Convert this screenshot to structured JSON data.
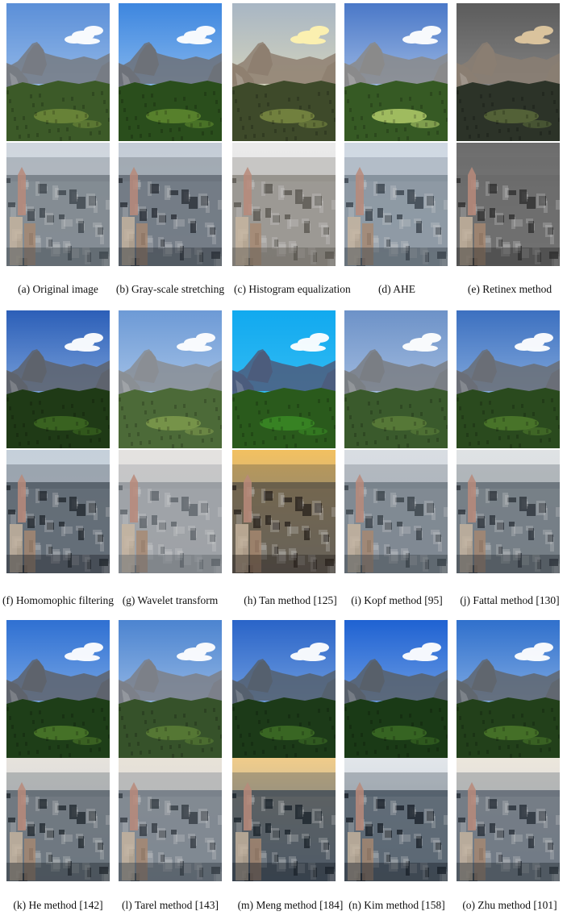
{
  "groups": [
    {
      "captions": [
        "(a) Original image",
        "(b) Gray-scale stretching",
        "(c) Histogram equalization",
        "(d) AHE",
        "(e) Retinex method"
      ],
      "panels": [
        {
          "mountain": {
            "sky_top": "#5b8fd8",
            "sky_bottom": "#b7d3f2",
            "cliff": "#777b83",
            "forest": "#3c5a28",
            "meadow": "#6f8a3a",
            "cloud": "#ffffff"
          },
          "city": {
            "sky": "#cfd6de",
            "haze": "#d9dee4",
            "buildings": "#6f7880",
            "shade": "#3f464d"
          }
        },
        {
          "mountain": {
            "sky_top": "#3d86df",
            "sky_bottom": "#b5d7f7",
            "cliff": "#6d7178",
            "forest": "#2a4e1c",
            "meadow": "#5f8a2f",
            "cloud": "#ffffff"
          },
          "city": {
            "sky": "#c4ccd6",
            "haze": "#d2dae2",
            "buildings": "#5e6770",
            "shade": "#2a3037"
          }
        },
        {
          "mountain": {
            "sky_top": "#a8b6c4",
            "sky_bottom": "#f0e6b8",
            "cliff": "#8e7f70",
            "forest": "#3e4a2a",
            "meadow": "#7a8a42",
            "cloud": "#fff3b0"
          },
          "city": {
            "sky": "#eaeaea",
            "haze": "#e2e2e2",
            "buildings": "#8a8680",
            "shade": "#5a5650"
          }
        },
        {
          "mountain": {
            "sky_top": "#4a78c8",
            "sky_bottom": "#d2e2f5",
            "cliff": "#8a8a8a",
            "forest": "#365a24",
            "meadow": "#b2cc6a",
            "cloud": "#ffffff"
          },
          "city": {
            "sky": "#cfd8e2",
            "haze": "#dde4ec",
            "buildings": "#7c8894",
            "shade": "#3a424c"
          }
        },
        {
          "mountain": {
            "sky_top": "#5c5c5c",
            "sky_bottom": "#9c9c9c",
            "cliff": "#8a7e72",
            "forest": "#2c3328",
            "meadow": "#5a6a3a",
            "cloud": "#e0c8a0"
          },
          "city": {
            "sky": "#6c6c6c",
            "haze": "#8a8a8a",
            "buildings": "#6a6a6a",
            "shade": "#2e2e2e"
          }
        }
      ]
    },
    {
      "captions": [
        "(f) Homomophic filtering",
        "(g) Wavelet transform",
        "(h) Tan method [125]",
        "(i) Kopf method [95]",
        "(j) Fattal method [130]"
      ],
      "panels": [
        {
          "mountain": {
            "sky_top": "#2c5fb8",
            "sky_bottom": "#a9c9ee",
            "cliff": "#5e636c",
            "forest": "#1f3a16",
            "meadow": "#3e6a22",
            "cloud": "#ffffff"
          },
          "city": {
            "sky": "#c5d0da",
            "haze": "#d0d8e0",
            "buildings": "#4a545e",
            "shade": "#23292f"
          }
        },
        {
          "mountain": {
            "sky_top": "#6d9ad6",
            "sky_bottom": "#c8dcf1",
            "cliff": "#8a8e94",
            "forest": "#4c6a38",
            "meadow": "#7e9a4c",
            "cloud": "#ffffff"
          },
          "city": {
            "sky": "#e4e2e0",
            "haze": "#dcdcdc",
            "buildings": "#8e949a",
            "shade": "#5e646a"
          }
        },
        {
          "mountain": {
            "sky_top": "#11a9ef",
            "sky_bottom": "#48c8f6",
            "cliff": "#4c5c7c",
            "forest": "#2a5a1c",
            "meadow": "#3a8a24",
            "cloud": "#ffffff"
          },
          "city": {
            "sky": "#f2c060",
            "haze": "#9aa0a8",
            "buildings": "#5a5246",
            "shade": "#2a241e"
          }
        },
        {
          "mountain": {
            "sky_top": "#6d92c8",
            "sky_bottom": "#c4d6ee",
            "cliff": "#7a7e84",
            "forest": "#3a5a2c",
            "meadow": "#5c7e3a",
            "cloud": "#ffffff"
          },
          "city": {
            "sky": "#d8dde2",
            "haze": "#cfd6dd",
            "buildings": "#6c7680",
            "shade": "#3a424a"
          }
        },
        {
          "mountain": {
            "sky_top": "#3c70c0",
            "sky_bottom": "#b0cdee",
            "cliff": "#6a6e76",
            "forest": "#2a4a1e",
            "meadow": "#4e7a2c",
            "cloud": "#ffffff"
          },
          "city": {
            "sky": "#dfe2e4",
            "haze": "#d2d8dc",
            "buildings": "#5e6870",
            "shade": "#2e353c"
          }
        }
      ]
    },
    {
      "captions": [
        "(k) He method [142]",
        "(l) Tarel method [143]",
        "(m) Meng method [184]",
        "(n) Kim method [158]",
        "(o) Zhu method [101]"
      ],
      "panels": [
        {
          "mountain": {
            "sky_top": "#2f70d2",
            "sky_bottom": "#a6c9f2",
            "cliff": "#5e636c",
            "forest": "#1e3e18",
            "meadow": "#4c7a2a",
            "cloud": "#ffffff"
          },
          "city": {
            "sky": "#e6e2dc",
            "haze": "#c9d3dc",
            "buildings": "#56606a",
            "shade": "#232a31"
          }
        },
        {
          "mountain": {
            "sky_top": "#4c84d0",
            "sky_bottom": "#c2d8f2",
            "cliff": "#7c8088",
            "forest": "#36522a",
            "meadow": "#5a7e36",
            "cloud": "#ffffff"
          },
          "city": {
            "sky": "#e8e2d8",
            "haze": "#d2d8de",
            "buildings": "#6a7480",
            "shade": "#343c44"
          }
        },
        {
          "mountain": {
            "sky_top": "#2a64c8",
            "sky_bottom": "#9cc2ee",
            "cliff": "#55606e",
            "forest": "#1c3a18",
            "meadow": "#3e6e26",
            "cloud": "#ffffff"
          },
          "city": {
            "sky": "#f0cc8a",
            "haze": "#8e9eae",
            "buildings": "#3e4a56",
            "shade": "#1c242c"
          }
        },
        {
          "mountain": {
            "sky_top": "#1f62d2",
            "sky_bottom": "#9dc2f0",
            "cliff": "#58606a",
            "forest": "#1a3a16",
            "meadow": "#3c6c24",
            "cloud": "#ffffff"
          },
          "city": {
            "sky": "#e2e6ea",
            "haze": "#b8c6d2",
            "buildings": "#44505c",
            "shade": "#1a222a"
          }
        },
        {
          "mountain": {
            "sky_top": "#3070cc",
            "sky_bottom": "#b2d0f2",
            "cliff": "#60666e",
            "forest": "#22401a",
            "meadow": "#4a782a",
            "cloud": "#ffffff"
          },
          "city": {
            "sky": "#ece6dc",
            "haze": "#ccd4dc",
            "buildings": "#5a6470",
            "shade": "#283038"
          }
        }
      ]
    }
  ]
}
